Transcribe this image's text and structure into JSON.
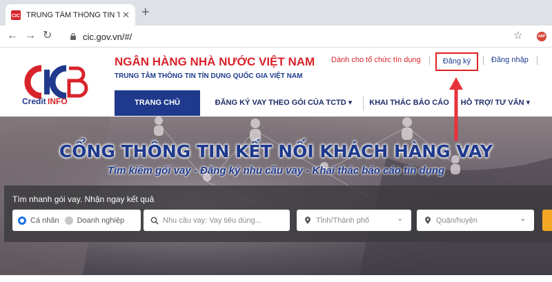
{
  "browser": {
    "tab_title": "TRUNG TÂM THÔNG TIN TÍN DỤ",
    "tab_close": "✕",
    "new_tab": "+",
    "url": "cic.gov.vn/#/",
    "abp_label": "ABP"
  },
  "header": {
    "logo_text": "CreditINFO",
    "org_name": "NGÂN HÀNG NHÀ NƯỚC VIỆT NAM",
    "org_sub": "TRUNG TÂM THÔNG TIN TÍN DỤNG QUỐC GIA VIỆT NAM",
    "links": {
      "tctd": "Dành cho tổ chức tín dụng",
      "register": "Đăng ký",
      "login": "Đăng nhập"
    }
  },
  "nav": {
    "items": [
      {
        "label": "TRANG CHỦ"
      },
      {
        "label": "ĐĂNG KÝ VAY THEO GÓI CỦA TCTD ▾"
      },
      {
        "label": "KHAI THÁC BÁO CÁO"
      },
      {
        "label": "HỖ TRỢ/ TƯ VẤN ▾"
      }
    ]
  },
  "hero": {
    "title": "CỔNG THÔNG TIN KẾT NỐI KHÁCH HÀNG VAY",
    "subtitle": "Tìm kiếm gói vay - Đăng ký nhu cầu vay - Khai thác báo cáo tín dụng"
  },
  "search": {
    "label": "Tìm nhanh gói vay. Nhận ngay kết quả",
    "radio_personal": "Cá nhân",
    "radio_business": "Doanh nghiệp",
    "need_placeholder": "Nhu cầu vay: Vay tiêu dùng...",
    "province_placeholder": "Tỉnh/Thành phố",
    "district_placeholder": "Quận/huyện"
  },
  "colors": {
    "brand_red": "#d8232a",
    "brand_blue": "#1f3a8c",
    "highlight_red": "#e02020"
  }
}
